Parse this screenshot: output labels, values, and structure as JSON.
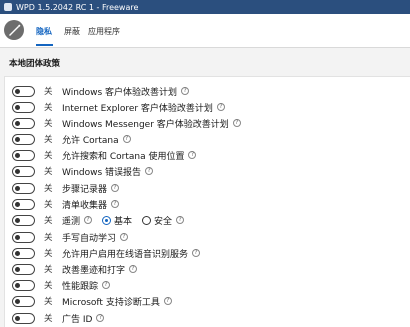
{
  "window": {
    "title": "WPD 1.5.2042 RC 1 - Freeware"
  },
  "tabs": [
    {
      "label": "隐私"
    },
    {
      "label": "屏蔽"
    },
    {
      "label": "应用程序"
    }
  ],
  "section": {
    "title": "本地团体政策"
  },
  "state_label": "关",
  "rows": [
    {
      "label": "Windows 客户体验改善计划"
    },
    {
      "label": "Internet Explorer 客户体验改善计划"
    },
    {
      "label": "Windows Messenger 客户体验改善计划"
    },
    {
      "label": "允许 Cortana"
    },
    {
      "label": "允许搜索和 Cortana 使用位置"
    },
    {
      "label": "Windows 错误报告"
    },
    {
      "label": "步骤记录器"
    },
    {
      "label": "清单收集器"
    },
    {
      "label": "遥测",
      "radio": {
        "option1": "基本",
        "option2": "安全",
        "selected": "基本"
      }
    },
    {
      "label": "手写自动学习"
    },
    {
      "label": "允许用户启用在线语音识别服务"
    },
    {
      "label": "改善墨迹和打字"
    },
    {
      "label": "性能跟踪"
    },
    {
      "label": "Microsoft 支持诊断工具"
    },
    {
      "label": "广告 ID"
    }
  ]
}
